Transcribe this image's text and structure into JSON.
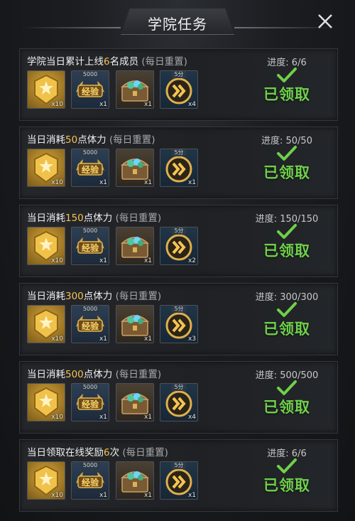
{
  "header": {
    "title": "学院任务"
  },
  "colors": {
    "accent": "#f5c451",
    "claimed": "#6fd04a"
  },
  "tasks": [
    {
      "title_pre": "学院当日累计上线",
      "title_hl": "6",
      "title_post": "名成员",
      "note": "(每日重置)",
      "progress": "进度: 6/6",
      "status": "已领取",
      "rewards": [
        {
          "icon": "gold-medal-icon",
          "count": "x10"
        },
        {
          "icon": "exp-book-icon",
          "tag": "5000",
          "label": "经验",
          "count": "x1"
        },
        {
          "icon": "treasure-chest-icon",
          "count": "x1"
        },
        {
          "icon": "speedup-icon",
          "tag": "5分",
          "count": "x4"
        }
      ]
    },
    {
      "title_pre": "当日消耗",
      "title_hl": "50",
      "title_post": "点体力",
      "note": "(每日重置)",
      "progress": "进度: 50/50",
      "status": "已领取",
      "rewards": [
        {
          "icon": "gold-medal-icon",
          "count": "x10"
        },
        {
          "icon": "exp-book-icon",
          "tag": "5000",
          "label": "经验",
          "count": "x1"
        },
        {
          "icon": "treasure-chest-icon",
          "count": "x1"
        },
        {
          "icon": "speedup-icon",
          "tag": "5分",
          "count": "x1"
        }
      ]
    },
    {
      "title_pre": "当日消耗",
      "title_hl": "150",
      "title_post": "点体力",
      "note": "(每日重置)",
      "progress": "进度: 150/150",
      "status": "已领取",
      "rewards": [
        {
          "icon": "gold-medal-icon",
          "count": "x10"
        },
        {
          "icon": "exp-book-icon",
          "tag": "5000",
          "label": "经验",
          "count": "x1"
        },
        {
          "icon": "treasure-chest-icon",
          "count": "x1"
        },
        {
          "icon": "speedup-icon",
          "tag": "5分",
          "count": "x2"
        }
      ]
    },
    {
      "title_pre": "当日消耗",
      "title_hl": "300",
      "title_post": "点体力",
      "note": "(每日重置)",
      "progress": "进度: 300/300",
      "status": "已领取",
      "rewards": [
        {
          "icon": "gold-medal-icon",
          "count": "x10"
        },
        {
          "icon": "exp-book-icon",
          "tag": "5000",
          "label": "经验",
          "count": "x1"
        },
        {
          "icon": "treasure-chest-icon",
          "count": "x1"
        },
        {
          "icon": "speedup-icon",
          "tag": "5分",
          "count": "x3"
        }
      ]
    },
    {
      "title_pre": "当日消耗",
      "title_hl": "500",
      "title_post": "点体力",
      "note": "(每日重置)",
      "progress": "进度: 500/500",
      "status": "已领取",
      "rewards": [
        {
          "icon": "gold-medal-icon",
          "count": "x10"
        },
        {
          "icon": "exp-book-icon",
          "tag": "5000",
          "label": "经验",
          "count": "x1"
        },
        {
          "icon": "treasure-chest-icon",
          "count": "x1"
        },
        {
          "icon": "speedup-icon",
          "tag": "5分",
          "count": "x4"
        }
      ]
    },
    {
      "title_pre": "当日领取在线奖励",
      "title_hl": "6",
      "title_post": "次",
      "note": "(每日重置)",
      "progress": "进度: 6/6",
      "status": "已领取",
      "rewards": [
        {
          "icon": "gold-medal-icon",
          "count": "x10"
        },
        {
          "icon": "exp-book-icon",
          "tag": "5000",
          "label": "经验",
          "count": "x1"
        },
        {
          "icon": "treasure-chest-icon",
          "count": "x1"
        },
        {
          "icon": "speedup-icon",
          "tag": "5分",
          "count": "x1"
        }
      ]
    }
  ]
}
